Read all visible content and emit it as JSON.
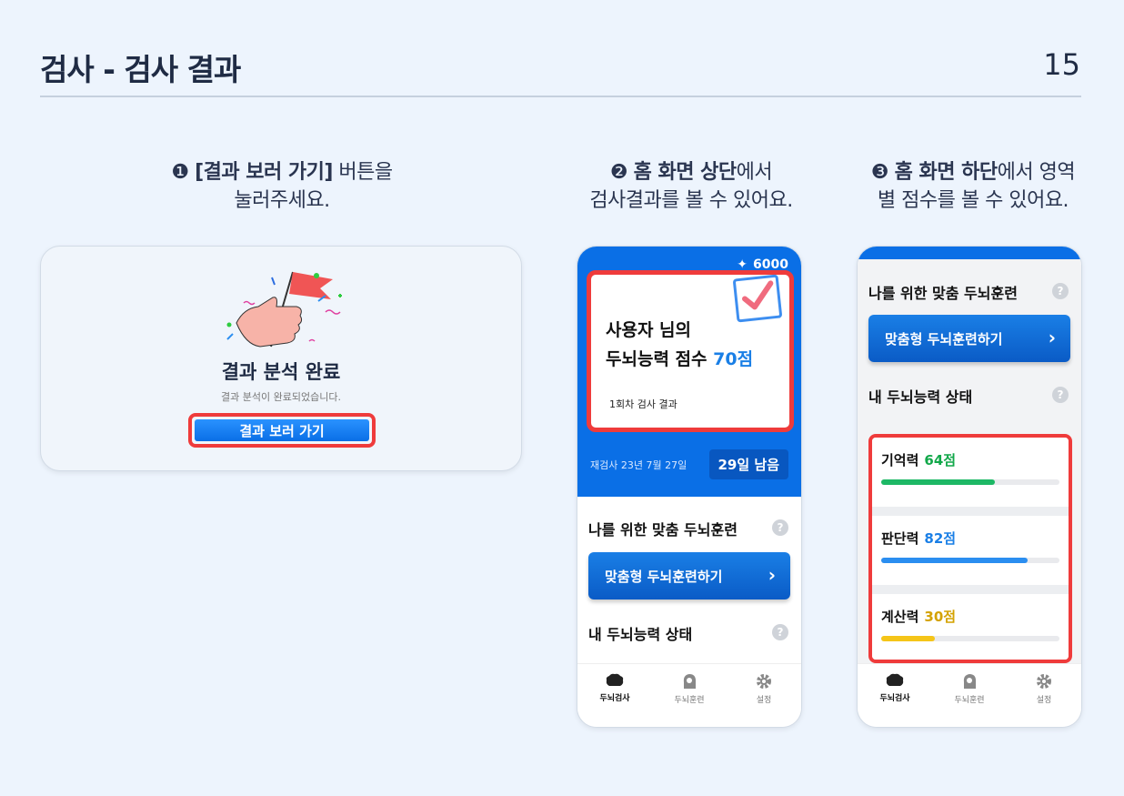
{
  "slide": {
    "title": "검사 - 검사 결과",
    "page_number": "15"
  },
  "steps": [
    {
      "marker": "❶",
      "bold": "[결과 보러 가기]",
      "rest": " 버튼을",
      "line2": "눌러주세요."
    },
    {
      "marker": "❷",
      "bold": "홈 화면 상단",
      "rest": "에서",
      "line2": "검사결과를 볼 수 있어요."
    },
    {
      "marker": "❸",
      "bold": "홈 화면 하단",
      "rest": "에서 영역",
      "line2": "별 점수를 볼 수 있어요."
    }
  ],
  "result_card": {
    "title": "결과 분석 완료",
    "subtitle": "결과 분석이 완료되었습니다.",
    "button_label": "결과 보러 가기"
  },
  "home_top": {
    "coins": "6000",
    "score_line1": "사용자 님의",
    "score_line2_prefix": "두뇌능력 점수 ",
    "score_value": "70점",
    "round_label": "1회차 검사 결과",
    "retest_label": "재검사 23년 7월 27일",
    "days_left": "29일 남음"
  },
  "sections": {
    "training_heading": "나를 위한 맞춤 두뇌훈련",
    "training_button": "맞춤형 두뇌훈련하기",
    "chevron": "›",
    "status_heading": "내 두뇌능력 상태",
    "help": "?"
  },
  "stats": [
    {
      "label": "기억력",
      "value": "64점",
      "score": 64,
      "color": "#12a84a",
      "bar": "#1db865"
    },
    {
      "label": "판단력",
      "value": "82점",
      "score": 82,
      "color": "#1a7fe6",
      "bar": "#2b8ef0"
    },
    {
      "label": "계산력",
      "value": "30점",
      "score": 30,
      "color": "#d4a200",
      "bar": "#f5c518"
    }
  ],
  "tabs": [
    {
      "label": "두뇌검사",
      "icon": "brain-icon"
    },
    {
      "label": "두뇌훈련",
      "icon": "head-icon"
    },
    {
      "label": "설정",
      "icon": "gear-icon"
    }
  ]
}
